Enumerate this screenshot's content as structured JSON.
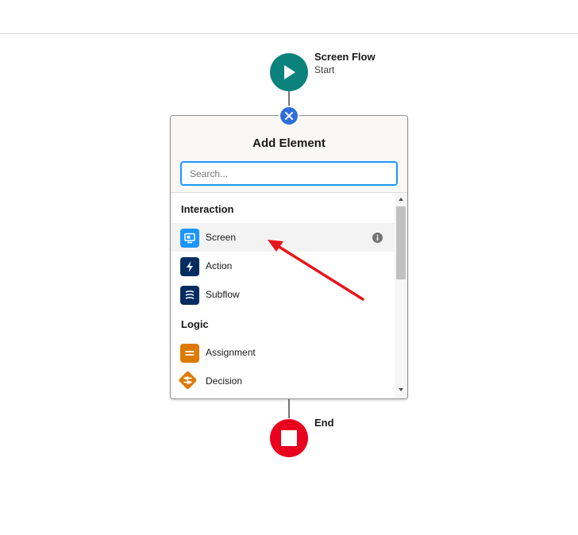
{
  "flow": {
    "start": {
      "title": "Screen Flow",
      "subtitle": "Start",
      "color": "#0b827c"
    },
    "end": {
      "title": "End",
      "color": "#ea001e"
    }
  },
  "panel": {
    "title": "Add Element",
    "search": {
      "placeholder": "Search...",
      "value": ""
    },
    "sections": [
      {
        "label": "Interaction",
        "items": [
          {
            "label": "Screen",
            "icon": "screen-icon",
            "color": "#1b96ff"
          },
          {
            "label": "Action",
            "icon": "lightning-bolt-icon",
            "color": "#032d60"
          },
          {
            "label": "Subflow",
            "icon": "subflow-icon",
            "color": "#032d60"
          }
        ]
      },
      {
        "label": "Logic",
        "items": [
          {
            "label": "Assignment",
            "icon": "assignment-icon",
            "color": "#dd7a01"
          },
          {
            "label": "Decision",
            "icon": "decision-icon",
            "color": "#dd7a01"
          }
        ]
      }
    ]
  },
  "colors": {
    "close_button": "#2e6ed8",
    "annotation_arrow": "#e8141b",
    "search_focus": "#1b96ff"
  }
}
